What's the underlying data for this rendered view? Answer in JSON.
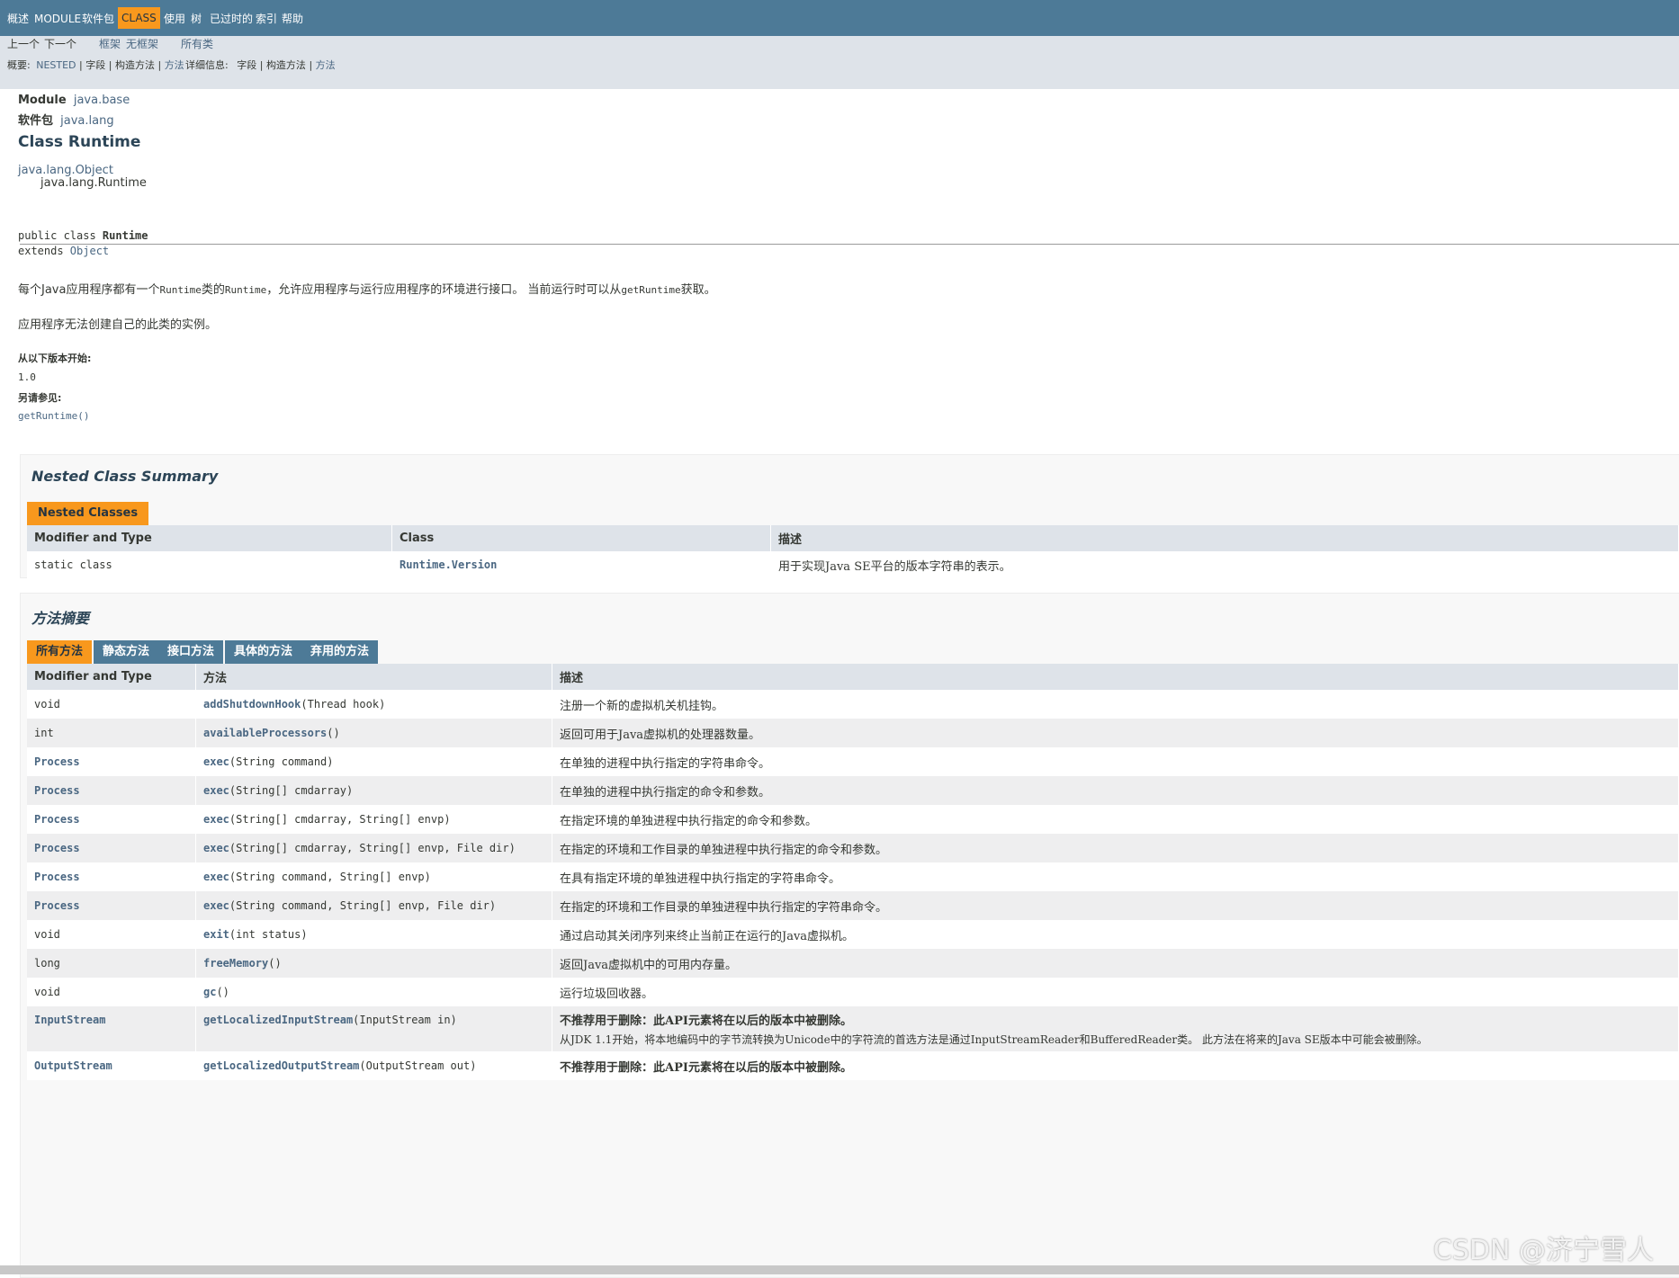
{
  "topnav": {
    "items": [
      "概述",
      "MODULE",
      "软件包",
      "CLASS",
      "使用",
      "树",
      "已过时的",
      "索引",
      "帮助"
    ]
  },
  "subnav": {
    "prev": "上一个",
    "next": "下一个",
    "frames": "框架",
    "noframes": "无框架",
    "allclasses": "所有类",
    "summary_label": "概要:",
    "summary_nested": "NESTED",
    "summary_field": "字段",
    "summary_constr": "构造方法",
    "summary_method": "方法",
    "detail_label": "详细信息:",
    "detail_field": "字段",
    "detail_constr": "构造方法",
    "detail_method": "方法",
    "pipe": "|"
  },
  "header": {
    "module_label": "Module",
    "module_value": "java.base",
    "package_label": "软件包",
    "package_value": "java.lang",
    "title": "Class Runtime",
    "inherit_parent": "java.lang.Object",
    "inherit_child": "java.lang.Runtime"
  },
  "signature": {
    "line1_prefix": "public class ",
    "line1_name": "Runtime",
    "line2_prefix": "extends ",
    "line2_link": "Object"
  },
  "description": {
    "p1_a": "每个Java应用程序都有一个",
    "p1_code1": "Runtime",
    "p1_b": "类的",
    "p1_code2": "Runtime",
    "p1_c": "，允许应用程序与运行应用程序的环境进行接口。 当前运行时可以从",
    "p1_code3": "getRuntime",
    "p1_d": "获取。",
    "p2": "应用程序无法创建自己的此类的实例。",
    "since_label": "从以下版本开始:",
    "since_value": "1.0",
    "see_label": "另请参见:",
    "see_value": "getRuntime()"
  },
  "nested": {
    "heading": "Nested Class Summary",
    "tab": "Nested Classes",
    "headers": [
      "Modifier and Type",
      "Class",
      "描述"
    ],
    "rows": [
      {
        "type": "static class",
        "name": "Runtime.Version",
        "desc": "用于实现Java SE平台的版本字符串的表示。"
      }
    ]
  },
  "methods": {
    "heading": "方法摘要",
    "tabs": [
      "所有方法",
      "静态方法",
      "接口方法",
      "具体的方法",
      "弃用的方法"
    ],
    "headers": [
      "Modifier and Type",
      "方法",
      "描述"
    ],
    "rows": [
      {
        "type": "void",
        "name": "addShutdownHook",
        "params": "(Thread hook)",
        "desc": "注册一个新的虚拟机关机挂钩。"
      },
      {
        "type": "int",
        "name": "availableProcessors",
        "params": "()",
        "desc": "返回可用于Java虚拟机的处理器数量。"
      },
      {
        "type": "Process",
        "name": "exec",
        "params": "(String command)",
        "desc": "在单独的进程中执行指定的字符串命令。"
      },
      {
        "type": "Process",
        "name": "exec",
        "params": "(String[] cmdarray)",
        "desc": "在单独的进程中执行指定的命令和参数。"
      },
      {
        "type": "Process",
        "name": "exec",
        "params": "(String[] cmdarray, String[] envp)",
        "desc": "在指定环境的单独进程中执行指定的命令和参数。"
      },
      {
        "type": "Process",
        "name": "exec",
        "params": "(String[] cmdarray, String[] envp, File dir)",
        "desc": "在指定的环境和工作目录的单独进程中执行指定的命令和参数。"
      },
      {
        "type": "Process",
        "name": "exec",
        "params": "(String command, String[] envp)",
        "desc": "在具有指定环境的单独进程中执行指定的字符串命令。"
      },
      {
        "type": "Process",
        "name": "exec",
        "params": "(String command, String[] envp, File dir)",
        "desc": "在指定的环境和工作目录的单独进程中执行指定的字符串命令。"
      },
      {
        "type": "void",
        "name": "exit",
        "params": "(int status)",
        "desc": "通过启动其关闭序列来终止当前正在运行的Java虚拟机。"
      },
      {
        "type": "long",
        "name": "freeMemory",
        "params": "()",
        "desc": "返回Java虚拟机中的可用内存量。"
      },
      {
        "type": "void",
        "name": "gc",
        "params": "()",
        "desc": "运行垃圾回收器。"
      },
      {
        "type": "InputStream",
        "name": "getLocalizedInputStream",
        "params": "(InputStream in)",
        "desc": "不推荐用于删除：此API元素将在以后的版本中被删除。",
        "desc2": "从JDK 1.1开始，将本地编码中的字节流转换为Unicode中的字符流的首选方法是通过InputStreamReader和BufferedReader类。 此方法在将来的Java SE版本中可能会被删除。"
      },
      {
        "type": "OutputStream",
        "name": "getLocalizedOutputStream",
        "params": "(OutputStream out)",
        "desc": "不推荐用于删除：此API元素将在以后的版本中被删除。"
      }
    ]
  },
  "watermark": "CSDN @济宁雪人",
  "colors": {
    "nav_bg": "#4d7a97",
    "subnav_bg": "#dee3e9",
    "accent": "#f8981d",
    "link": "#4a6782"
  }
}
